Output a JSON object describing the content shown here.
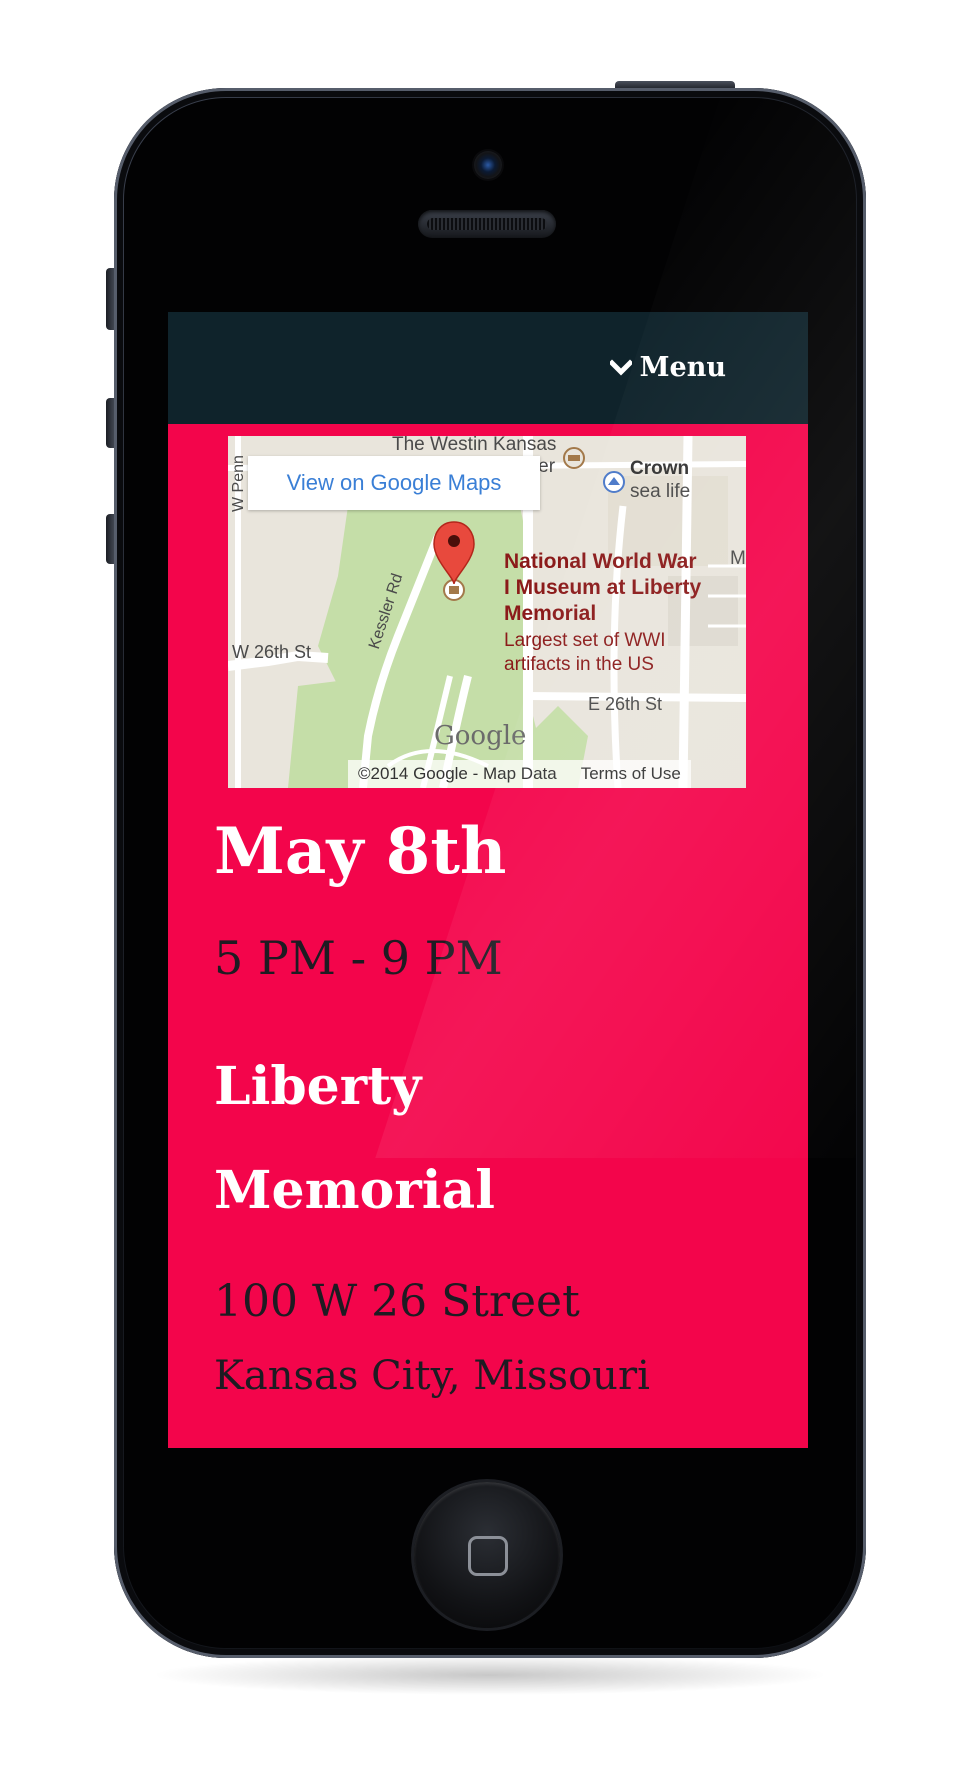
{
  "screen": {
    "background_color": "#f3054b",
    "navbar_color": "#0f232b"
  },
  "navbar": {
    "menu_label": "Menu",
    "menu_icon": "chevron-down-icon"
  },
  "map": {
    "view_button_label": "View on Google Maps",
    "place_name": "National World War I Museum at Liberty Memorial",
    "place_description": "Largest set of WWI artifacts in the US",
    "labels": {
      "westin": "The Westin Kansas",
      "center": "Center",
      "crown": "Crown",
      "sea_life": "sea life",
      "w_26th": "W 26th St",
      "kessler": "Kessler Rd",
      "e_26th": "E 26th St",
      "w_pen": "W Penn",
      "m_edge": "M"
    },
    "logo": "Google",
    "copyright": "©2014 Google - Map Data",
    "terms": "Terms of Use",
    "pin_icon": "map-pin-icon",
    "museum_icon": "museum-icon",
    "hotel_icon": "hotel-icon"
  },
  "event": {
    "date": "May 8th",
    "time": "5 PM - 9 PM",
    "venue_line1": "Liberty",
    "venue_line2": "Memorial",
    "address_line1": "100 W 26 Street",
    "address_line2": "Kansas City, Missouri"
  }
}
